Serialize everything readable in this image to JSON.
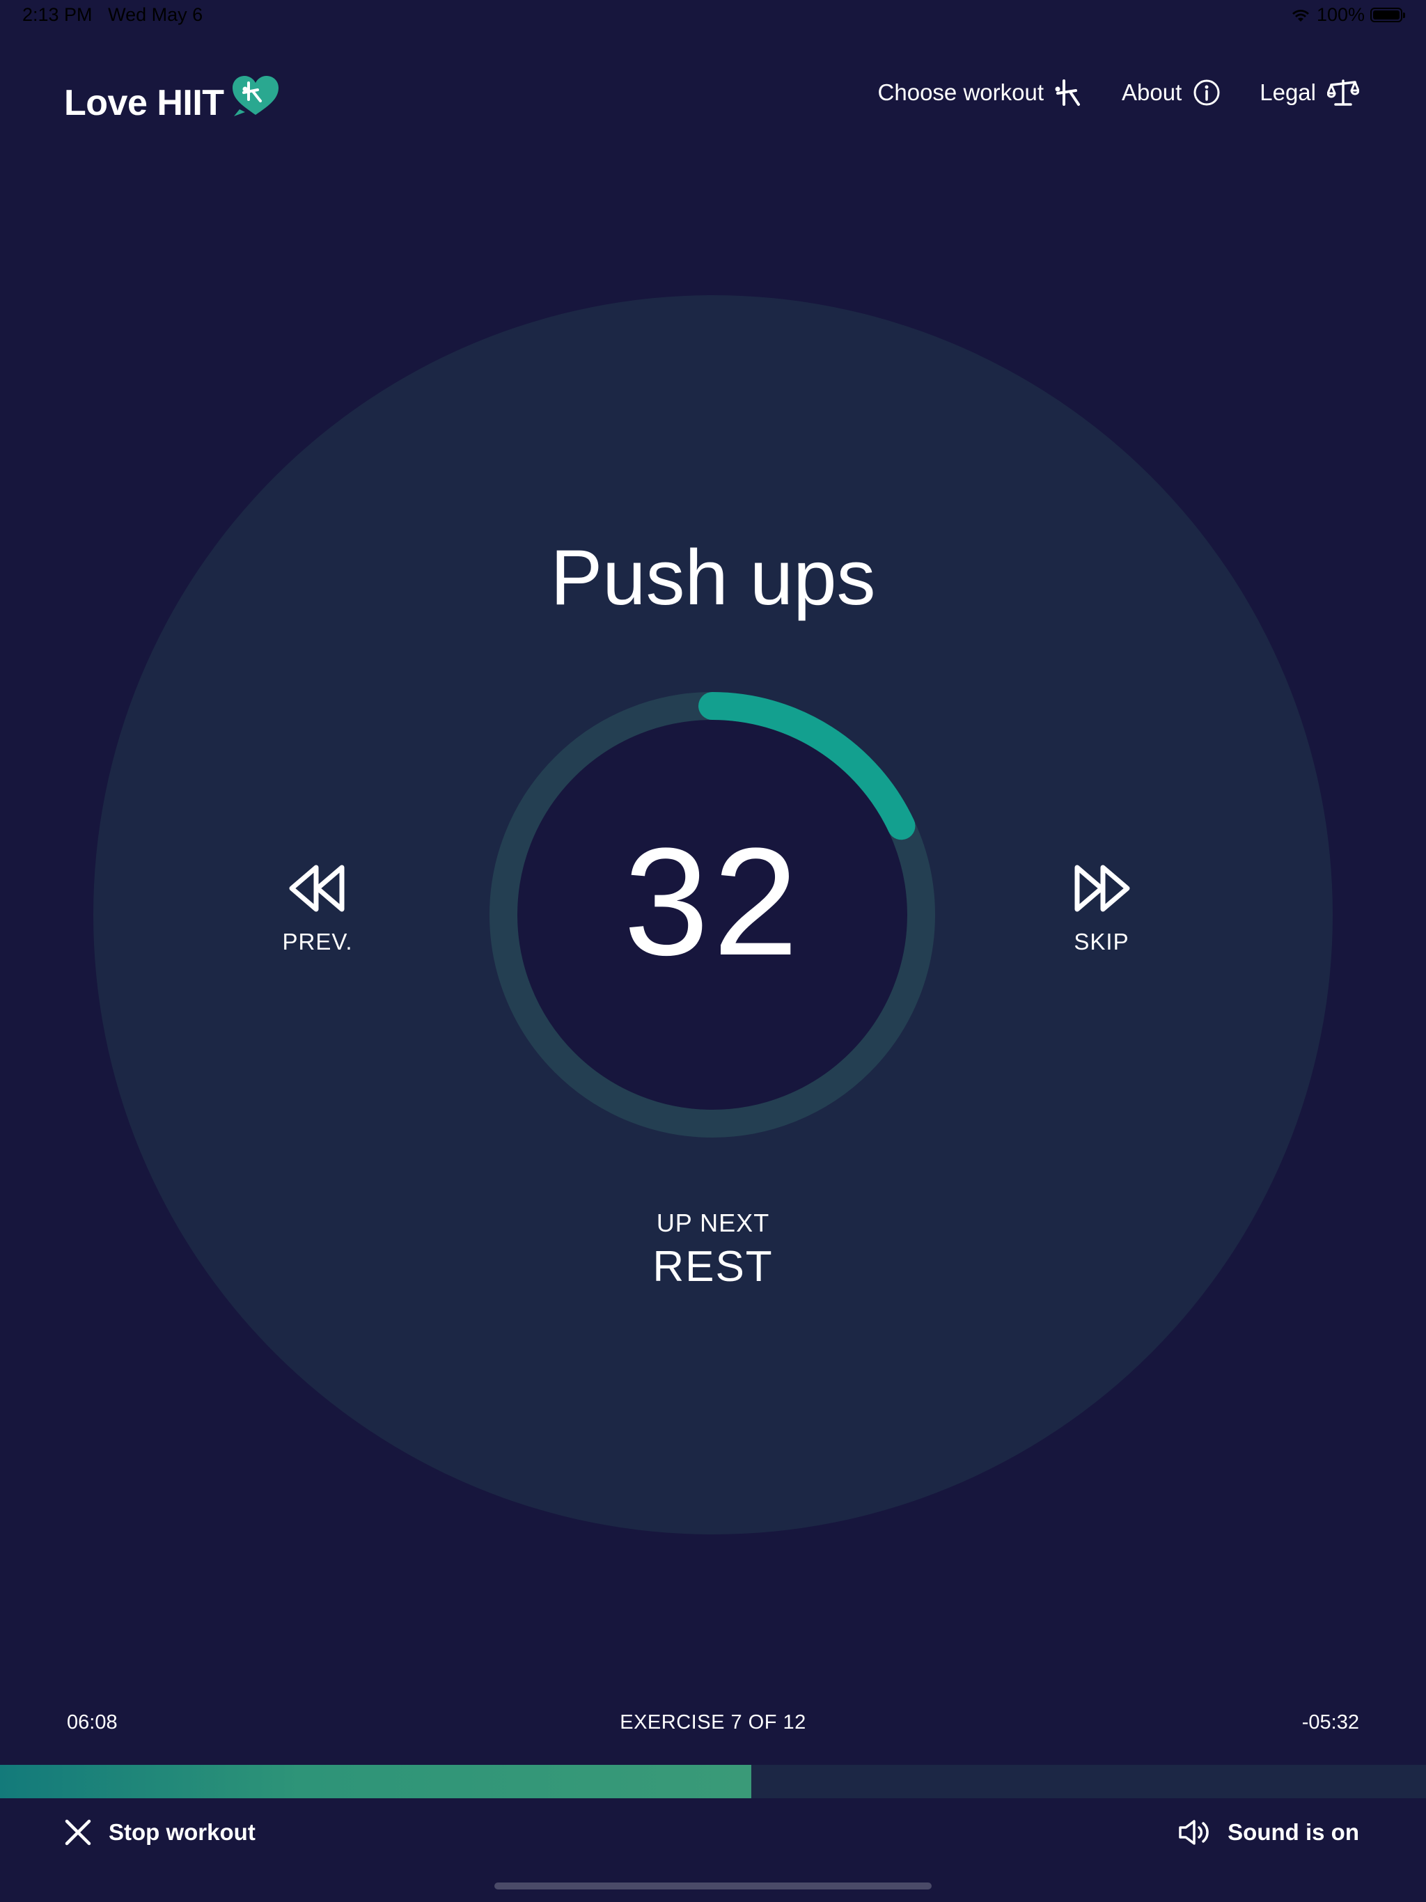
{
  "status_bar": {
    "time": "2:13 PM",
    "date": "Wed May 6",
    "battery": "100%"
  },
  "header": {
    "logo_text": "Love HIIT",
    "nav": [
      {
        "label": "Choose workout",
        "icon": "exercise-figure-icon"
      },
      {
        "label": "About",
        "icon": "info-icon"
      },
      {
        "label": "Legal",
        "icon": "scales-icon"
      }
    ]
  },
  "workout": {
    "exercise_name": "Push ups",
    "countdown": "32",
    "countdown_ring_progress": 0.18,
    "prev_label": "PREV.",
    "skip_label": "SKIP",
    "up_next_label": "UP NEXT",
    "up_next_value": "REST"
  },
  "progress": {
    "elapsed": "06:08",
    "exercise_counter": "EXERCISE 7 OF 12",
    "remaining": "-05:32",
    "fraction": 0.527
  },
  "footer": {
    "stop_label": "Stop workout",
    "sound_label": "Sound is on"
  },
  "colors": {
    "background": "#17163d",
    "circle": "#1c2745",
    "ring_track": "#243f52",
    "accent": "#13a08f"
  }
}
